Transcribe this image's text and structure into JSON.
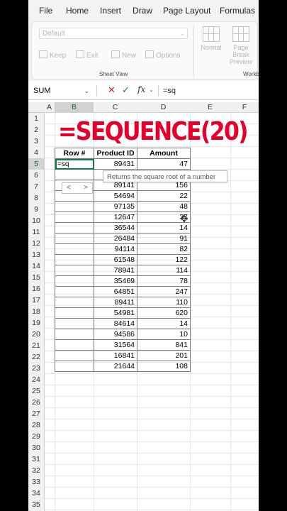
{
  "menu": [
    "File",
    "Home",
    "Insert",
    "Draw",
    "Page Layout",
    "Formulas"
  ],
  "ribbon": {
    "view_dropdown": "Default",
    "buttons": [
      "Keep",
      "Exit",
      "New",
      "Options"
    ],
    "group_label": "Sheet View",
    "big_buttons": [
      "Normal",
      "Page Break Preview"
    ],
    "group_label2": "Workbo"
  },
  "formula_bar": {
    "name_box": "SUM",
    "formula": "=sq",
    "fx": "fx"
  },
  "columns": [
    "A",
    "B",
    "C",
    "D",
    "E",
    "F"
  ],
  "rows": [
    "1",
    "2",
    "3",
    "4",
    "5",
    "6",
    "7",
    "8",
    "9",
    "10",
    "11",
    "12",
    "13",
    "14",
    "15",
    "16",
    "17",
    "18",
    "19",
    "20",
    "21",
    "22",
    "23",
    "24",
    "25",
    "26",
    "27",
    "28",
    "29",
    "30",
    "31",
    "32",
    "33",
    "34",
    "35"
  ],
  "title": "=SEQUENCE(20)",
  "table": {
    "headers": [
      "Row #",
      "Product ID",
      "Amount"
    ],
    "active_cell": "=sq",
    "product_ids": [
      "89431",
      "",
      "89141",
      "54694",
      "97135",
      "12647",
      "36544",
      "26484",
      "94114",
      "61548",
      "78941",
      "35469",
      "64851",
      "89411",
      "54981",
      "84614",
      "94586",
      "31564",
      "16841",
      "21644"
    ],
    "amounts": [
      "47",
      "",
      "156",
      "22",
      "48",
      "37",
      "14",
      "91",
      "82",
      "122",
      "114",
      "78",
      "247",
      "110",
      "620",
      "14",
      "10",
      "841",
      "201",
      "108"
    ]
  },
  "tooltip": "Returns the square root of a number",
  "autocomplete_nav": [
    "<",
    ">"
  ],
  "watermark": "InShOt"
}
